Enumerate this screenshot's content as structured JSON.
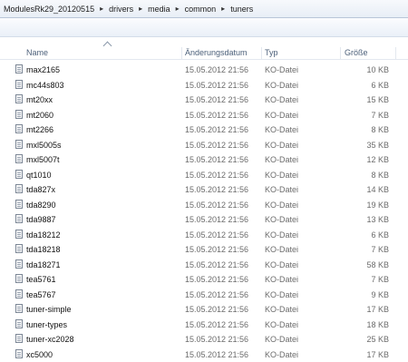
{
  "breadcrumb": [
    "ModulesRk29_20120515",
    "drivers",
    "media",
    "common",
    "tuners"
  ],
  "columns": {
    "name": "Name",
    "date": "Änderungsdatum",
    "type": "Typ",
    "size": "Größe"
  },
  "files": [
    {
      "name": "max2165",
      "date": "15.05.2012 21:56",
      "type": "KO-Datei",
      "size": "10 KB"
    },
    {
      "name": "mc44s803",
      "date": "15.05.2012 21:56",
      "type": "KO-Datei",
      "size": "6 KB"
    },
    {
      "name": "mt20xx",
      "date": "15.05.2012 21:56",
      "type": "KO-Datei",
      "size": "15 KB"
    },
    {
      "name": "mt2060",
      "date": "15.05.2012 21:56",
      "type": "KO-Datei",
      "size": "7 KB"
    },
    {
      "name": "mt2266",
      "date": "15.05.2012 21:56",
      "type": "KO-Datei",
      "size": "8 KB"
    },
    {
      "name": "mxl5005s",
      "date": "15.05.2012 21:56",
      "type": "KO-Datei",
      "size": "35 KB"
    },
    {
      "name": "mxl5007t",
      "date": "15.05.2012 21:56",
      "type": "KO-Datei",
      "size": "12 KB"
    },
    {
      "name": "qt1010",
      "date": "15.05.2012 21:56",
      "type": "KO-Datei",
      "size": "8 KB"
    },
    {
      "name": "tda827x",
      "date": "15.05.2012 21:56",
      "type": "KO-Datei",
      "size": "14 KB"
    },
    {
      "name": "tda8290",
      "date": "15.05.2012 21:56",
      "type": "KO-Datei",
      "size": "19 KB"
    },
    {
      "name": "tda9887",
      "date": "15.05.2012 21:56",
      "type": "KO-Datei",
      "size": "13 KB"
    },
    {
      "name": "tda18212",
      "date": "15.05.2012 21:56",
      "type": "KO-Datei",
      "size": "6 KB"
    },
    {
      "name": "tda18218",
      "date": "15.05.2012 21:56",
      "type": "KO-Datei",
      "size": "7 KB"
    },
    {
      "name": "tda18271",
      "date": "15.05.2012 21:56",
      "type": "KO-Datei",
      "size": "58 KB"
    },
    {
      "name": "tea5761",
      "date": "15.05.2012 21:56",
      "type": "KO-Datei",
      "size": "7 KB"
    },
    {
      "name": "tea5767",
      "date": "15.05.2012 21:56",
      "type": "KO-Datei",
      "size": "9 KB"
    },
    {
      "name": "tuner-simple",
      "date": "15.05.2012 21:56",
      "type": "KO-Datei",
      "size": "17 KB"
    },
    {
      "name": "tuner-types",
      "date": "15.05.2012 21:56",
      "type": "KO-Datei",
      "size": "18 KB"
    },
    {
      "name": "tuner-xc2028",
      "date": "15.05.2012 21:56",
      "type": "KO-Datei",
      "size": "25 KB"
    },
    {
      "name": "xc5000",
      "date": "15.05.2012 21:56",
      "type": "KO-Datei",
      "size": "17 KB"
    }
  ]
}
